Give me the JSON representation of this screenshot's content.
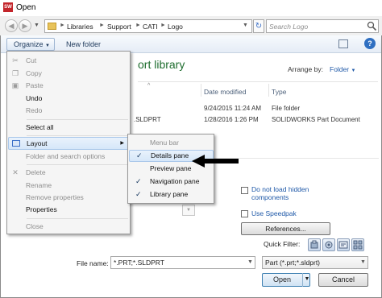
{
  "window": {
    "title": "Open",
    "app_icon": "solidworks-icon"
  },
  "address": {
    "crumbs": [
      "Libraries",
      "Support",
      "CATI",
      "Logo"
    ],
    "search_placeholder": "Search Logo"
  },
  "toolbar": {
    "organize_label": "Organize",
    "new_folder_label": "New folder"
  },
  "library": {
    "title_fragment": "ort library",
    "arrange_label": "Arrange by:",
    "arrange_value": "Folder"
  },
  "table": {
    "columns": [
      "Date modified",
      "Type"
    ],
    "rows": [
      {
        "name": "",
        "date": "9/24/2015 11:24 AM",
        "type": "File folder"
      },
      {
        "name": ".SLDPRT",
        "date": "1/28/2016 1:26 PM",
        "type": "SOLIDWORKS Part Document"
      }
    ]
  },
  "organize_menu": {
    "items": [
      {
        "label": "Cut",
        "enabled": false,
        "icon": "cut-icon"
      },
      {
        "label": "Copy",
        "enabled": false,
        "icon": "copy-icon"
      },
      {
        "label": "Paste",
        "enabled": false,
        "icon": "paste-icon"
      },
      {
        "label": "Undo",
        "enabled": true
      },
      {
        "label": "Redo",
        "enabled": false
      },
      {
        "label": "Select all",
        "enabled": true
      },
      {
        "label": "Layout",
        "enabled": true,
        "icon": "layout-icon"
      },
      {
        "label": "Folder and search options",
        "enabled": false
      },
      {
        "label": "Delete",
        "enabled": false,
        "icon": "delete-icon"
      },
      {
        "label": "Rename",
        "enabled": false
      },
      {
        "label": "Remove properties",
        "enabled": false
      },
      {
        "label": "Properties",
        "enabled": true
      },
      {
        "label": "Close",
        "enabled": false
      }
    ]
  },
  "layout_submenu": {
    "items": [
      {
        "label": "Menu bar",
        "checked": false
      },
      {
        "label": "Details pane",
        "checked": true
      },
      {
        "label": "Preview pane",
        "checked": false
      },
      {
        "label": "Navigation pane",
        "checked": true
      },
      {
        "label": "Library pane",
        "checked": true
      }
    ]
  },
  "options": {
    "do_not_load_hidden": "Do not load hidden components",
    "use_speedpak": "Use Speedpak",
    "references_label": "References...",
    "quick_filter_label": "Quick Filter:"
  },
  "bottom": {
    "file_name_label": "File name:",
    "file_name_value": "*.PRT;*.SLDPRT",
    "file_type_value": "Part (*.prt;*.sldprt)",
    "open_label": "Open",
    "cancel_label": "Cancel"
  },
  "colors": {
    "accent": "#1f59a8",
    "library_title": "#1e6d2e",
    "menu_bg": "#f5f5f5"
  }
}
